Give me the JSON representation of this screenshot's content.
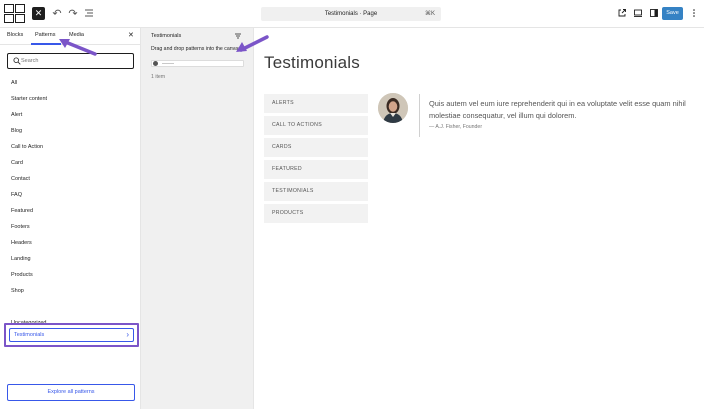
{
  "toolbar": {
    "document_title": "Testimonials · Page",
    "shortcut": "⌘K",
    "save_label": "Save"
  },
  "sidebar": {
    "tabs": [
      "Blocks",
      "Patterns",
      "Media"
    ],
    "search_placeholder": "Search",
    "categories": [
      "All",
      "Starter content",
      "Alert",
      "Blog",
      "Call to Action",
      "Card",
      "Contact",
      "FAQ",
      "Featured",
      "Footers",
      "Headers",
      "Landing",
      "Products",
      "Shop"
    ],
    "selected_category": "Testimonials",
    "after_selected": "Uncategorized",
    "explore_label": "Explore all patterns"
  },
  "pattern_panel": {
    "title": "Testimonials",
    "hint": "Drag and drop patterns into the canvas.",
    "count": "1 item"
  },
  "canvas": {
    "heading": "Testimonials",
    "menu": [
      "ALERTS",
      "CALL TO ACTIONS",
      "CARDS",
      "FEATURED",
      "TESTIMONIALS",
      "PRODUCTS"
    ],
    "quote": "Quis autem vel eum iure reprehenderit qui in ea voluptate velit esse quam nihil molestiae consequatur, vel illum qui dolorem.",
    "cite": "— A.J. Fisher, Founder"
  },
  "colors": {
    "accent": "#3858e9",
    "save_button": "#3582c4",
    "highlight_frame": "#7b55c8",
    "arrow": "#7b55c8"
  }
}
